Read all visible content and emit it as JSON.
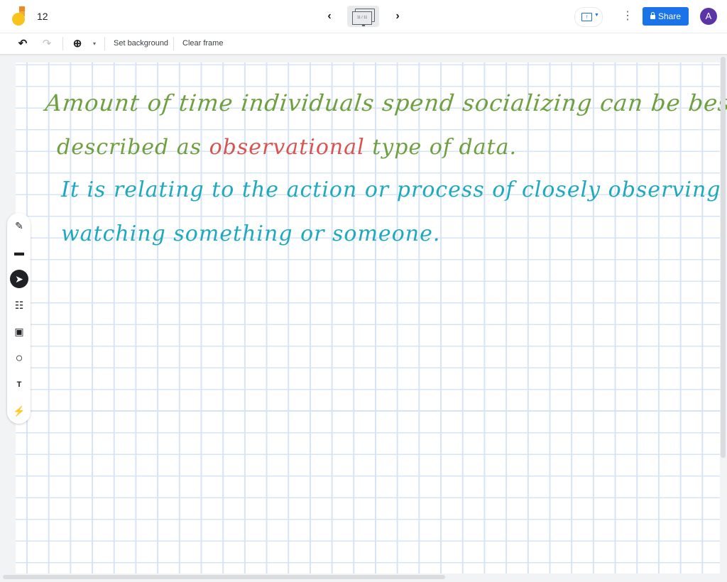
{
  "header": {
    "title": "12",
    "frame_indicator": "11 / 11",
    "prev_icon": "chevron-left-icon",
    "next_icon": "chevron-right-icon",
    "cast_icon": "present-to-screen-icon",
    "more_icon": "more-vert-icon",
    "share_label": "Share",
    "avatar_initial": "A",
    "accent_color": "#1a73e8",
    "avatar_color": "#5b35a8"
  },
  "toolbar": {
    "undo_icon": "↶",
    "redo_icon": "↷",
    "zoom_icon": "⊕",
    "zoom_caret": "▾",
    "set_background_label": "Set background",
    "clear_frame_label": "Clear frame"
  },
  "tools": [
    {
      "name": "pen",
      "glyph": "✎"
    },
    {
      "name": "eraser",
      "glyph": "▬"
    },
    {
      "name": "select",
      "glyph": "➤",
      "active": true
    },
    {
      "name": "sticky-note",
      "glyph": "☷"
    },
    {
      "name": "image",
      "glyph": "▣"
    },
    {
      "name": "circle",
      "glyph": "○"
    },
    {
      "name": "text-box",
      "glyph": "T"
    },
    {
      "name": "laser",
      "glyph": "⚡"
    }
  ],
  "canvas": {
    "lines": [
      {
        "text": "Amount of time individuals spend socializing can be best",
        "color": "#6fa03f"
      },
      {
        "segments": [
          {
            "text": "described as ",
            "color": "#6fa03f"
          },
          {
            "text": "observational",
            "color": "#d9534f"
          },
          {
            "text": " type of data.",
            "color": "#6fa03f"
          }
        ]
      },
      {
        "text": "It is relating to the action or process of closely observing or",
        "color": "#1fa9bf"
      },
      {
        "text": "watching something or someone.",
        "color": "#1fa9bf"
      }
    ]
  }
}
